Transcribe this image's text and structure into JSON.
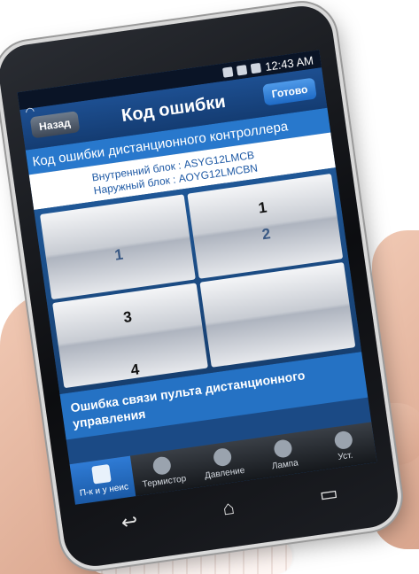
{
  "status_bar": {
    "time": "12:43 AM"
  },
  "header": {
    "back_label": "Назад",
    "title": "Код ошибки",
    "done_label": "Готово"
  },
  "subheader": "Код ошибки дистанционного контроллера",
  "units": {
    "indoor": "Внутренний блок : ASYG12LMCB",
    "outdoor": "Наружный блок : AOYG12LMCBN"
  },
  "error_grid": {
    "tile1": {
      "mid": "1"
    },
    "tile2": {
      "top": "1",
      "mid": "2"
    },
    "tile3": {
      "top": "3",
      "bot": "4"
    },
    "tile4": {}
  },
  "message": "Ошибка связи пульта дистанционного управления",
  "tabs": [
    {
      "label": "П-к и у неис",
      "icon": "list-icon"
    },
    {
      "label": "Термистор",
      "icon": "thermometer-icon"
    },
    {
      "label": "Давление",
      "icon": "gauge-icon"
    },
    {
      "label": "Лампа",
      "icon": "lamp-icon"
    },
    {
      "label": "Уст.",
      "icon": "gear-icon"
    }
  ],
  "colors": {
    "accent": "#2572c4",
    "header": "#143c72"
  }
}
